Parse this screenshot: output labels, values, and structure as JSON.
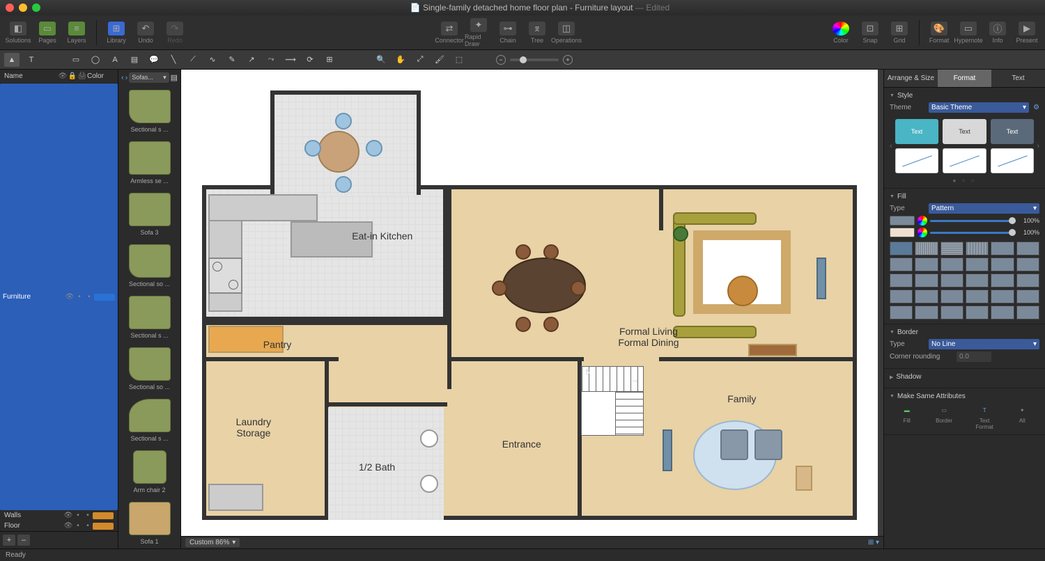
{
  "window": {
    "title": "Single-family detached home floor plan - Furniture layout",
    "edited": "— Edited"
  },
  "toolbar": {
    "solutions": "Solutions",
    "pages": "Pages",
    "layers": "Layers",
    "library": "Library",
    "undo": "Undo",
    "redo": "Redo",
    "connector": "Connector",
    "rapid": "Rapid Draw",
    "chain": "Chain",
    "tree": "Tree",
    "operations": "Operations",
    "color": "Color",
    "snap": "Snap",
    "grid": "Grid",
    "format": "Format",
    "hypernote": "Hypernote",
    "info": "Info",
    "present": "Present"
  },
  "layers_panel": {
    "head_name": "Name",
    "head_color": "Color",
    "rows": [
      {
        "name": "Furniture",
        "color": "#2a72d4",
        "selected": true
      },
      {
        "name": "Walls",
        "color": "#d48a2a",
        "selected": false
      },
      {
        "name": "Floor",
        "color": "#d48a2a",
        "selected": false
      }
    ],
    "add": "+",
    "remove": "–"
  },
  "library": {
    "dropdown": "Sofas...",
    "items": [
      {
        "label": "Sectional s ...",
        "cls": "s1"
      },
      {
        "label": "Armless se ...",
        "cls": "s3"
      },
      {
        "label": "Sofa 3",
        "cls": "s3"
      },
      {
        "label": "Sectional so ...",
        "cls": "s1"
      },
      {
        "label": "Sectional s ...",
        "cls": "s3"
      },
      {
        "label": "Sectional so ...",
        "cls": "s1"
      },
      {
        "label": "Sectional s ...",
        "cls": "round"
      },
      {
        "label": "Arm chair 2",
        "cls": "chair"
      },
      {
        "label": "Sofa 1",
        "cls": "table"
      }
    ]
  },
  "canvas_bar": {
    "zoom": "Custom 86%"
  },
  "inspector": {
    "tabs": {
      "arrange": "Arrange & Size",
      "format": "Format",
      "text": "Text"
    },
    "style": {
      "head": "Style",
      "theme_label": "Theme",
      "theme_value": "Basic Theme",
      "text": "Text"
    },
    "fill": {
      "head": "Fill",
      "type_label": "Type",
      "type_value": "Pattern",
      "pct": "100%"
    },
    "border": {
      "head": "Border",
      "type_label": "Type",
      "type_value": "No Line",
      "corner_label": "Corner rounding",
      "corner_value": "0.0"
    },
    "shadow": {
      "head": "Shadow"
    },
    "same": {
      "head": "Make Same Attributes",
      "fill": "Fill",
      "border": "Border",
      "textf": "Text\nFormat",
      "all": "All"
    }
  },
  "plan": {
    "kitchen": "Eat-in Kitchen",
    "pantry": "Pantry",
    "laundry": "Laundry\nStorage",
    "bath": "1/2 Bath",
    "entrance": "Entrance",
    "living": "Formal Living\nFormal Dining",
    "family": "Family",
    "stairs": "5"
  },
  "status": {
    "ready": "Ready"
  }
}
